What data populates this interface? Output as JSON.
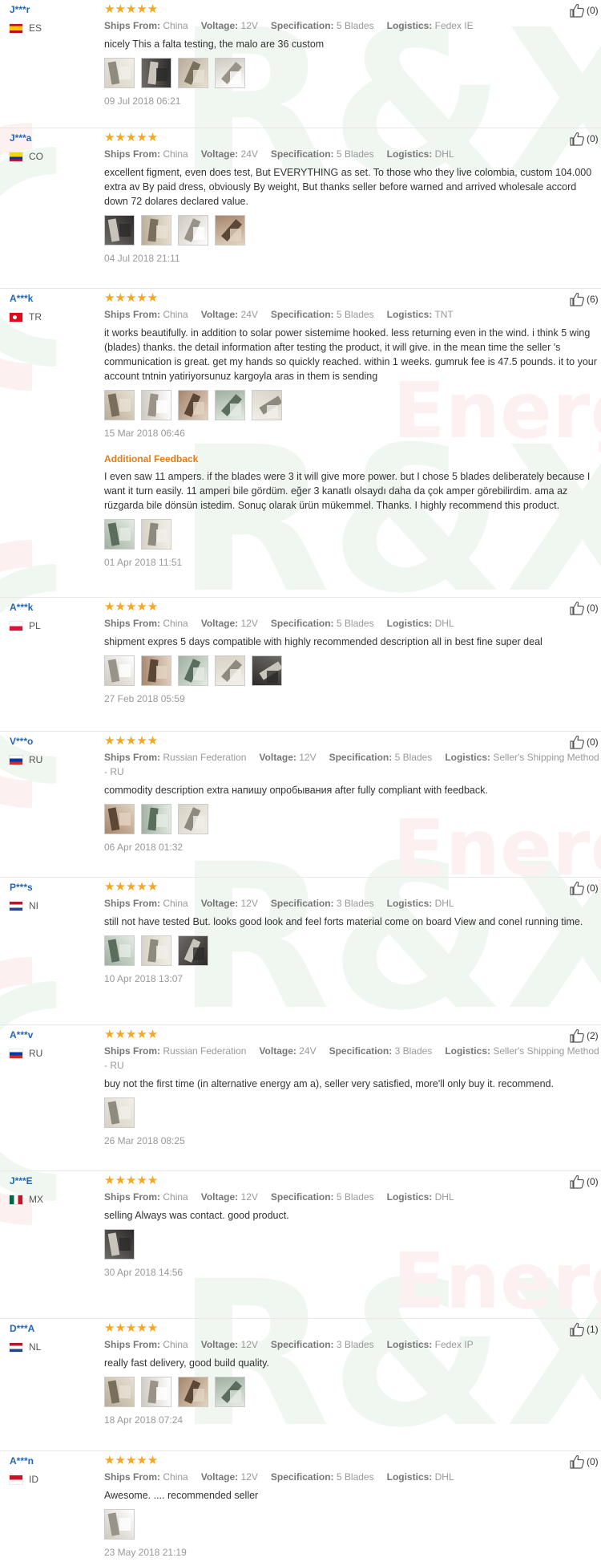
{
  "watermark": {
    "brand": "R&X",
    "word": "Energy"
  },
  "labels": {
    "ships_from": "Ships From:",
    "voltage": "Voltage:",
    "specification": "Specification:",
    "logistics": "Logistics:",
    "additional_feedback": "Additional Feedback"
  },
  "colors": {
    "star": "#f5a623",
    "user_name": "#2366b8",
    "feedback_title": "#e07d19"
  },
  "reviews": [
    {
      "user": "J***r",
      "country": "ES",
      "flag": "flag-es",
      "stars": "★★★★★",
      "ships_from": "China",
      "voltage": "12V",
      "specification": "5 Blades",
      "logistics": "Fedex IE",
      "text": "nicely This a falta testing, the malo are 36 custom",
      "photos": 4,
      "date": "09 Jul 2018 06:21",
      "helpful": "(0)"
    },
    {
      "user": "J***a",
      "country": "CO",
      "flag": "flag-co",
      "stars": "★★★★★",
      "ships_from": "China",
      "voltage": "24V",
      "specification": "5 Blades",
      "logistics": "DHL",
      "text": "excellent figment, even does test, But EVERYTHING as set. To those who they live colombia, custom 104.000 extra av By paid dress, obviously By weight, But thanks seller before warned and arrived wholesale accord down 72 dolares declared value.",
      "photos": 4,
      "date": "04 Jul 2018 21:11",
      "helpful": "(0)"
    },
    {
      "user": "A***k",
      "country": "TR",
      "flag": "flag-tr",
      "stars": "★★★★★",
      "ships_from": "China",
      "voltage": "24V",
      "specification": "5 Blades",
      "logistics": "TNT",
      "text": "it works beautifully. in addition to solar power sistemime hooked. less returning even in the wind. i think 5 wing (blades) thanks. the detail information after testing the product, it will give. in the mean time the seller 's communication is great. get my hands so quickly reached. within 1 weeks. gumruk fee is 47.5 pounds. it to your account tntnin yatiriyorsunuz kargoyla aras in them is sending",
      "photos": 5,
      "date": "15 Mar 2018 06:46",
      "helpful": "(6)",
      "additional": {
        "text": "I even saw 11 ampers. if the blades were 3 it will give more power. but I chose 5 blades deliberately because I want it turn easily. 11 amperi bile gördüm. eğer 3 kanatlı olsaydı daha da çok amper görebilirdim. ama az rüzgarda bile dönsün istedim. Sonuç olarak ürün mükemmel. Thanks. I highly recommend this product.",
        "photos": 2,
        "date": "01 Apr 2018 11:51"
      }
    },
    {
      "user": "A***k",
      "country": "PL",
      "flag": "flag-pl",
      "stars": "★★★★★",
      "ships_from": "China",
      "voltage": "12V",
      "specification": "5 Blades",
      "logistics": "DHL",
      "text": "shipment expres 5 days compatible with highly recommended description all in best fine super deal",
      "photos": 5,
      "date": "27 Feb 2018 05:59",
      "helpful": "(0)"
    },
    {
      "user": "V***o",
      "country": "RU",
      "flag": "flag-ru",
      "stars": "★★★★★",
      "ships_from": "Russian Federation",
      "voltage": "12V",
      "specification": "5 Blades",
      "logistics": "Seller's Shipping Method - RU",
      "text": "commodity description extra напишу опробывания after fully compliant with feedback.",
      "photos": 3,
      "date": "06 Apr 2018 01:32",
      "helpful": "(0)"
    },
    {
      "user": "P***s",
      "country": "NI",
      "flag": "flag-nl",
      "stars": "★★★★★",
      "ships_from": "China",
      "voltage": "12V",
      "specification": "3 Blades",
      "logistics": "DHL",
      "text": "still not have tested But. looks good look and feel forts material come on board View and conel running time.",
      "photos": 3,
      "date": "10 Apr 2018 13:07",
      "helpful": "(0)"
    },
    {
      "user": "A***v",
      "country": "RU",
      "flag": "flag-ru",
      "stars": "★★★★★",
      "ships_from": "Russian Federation",
      "voltage": "24V",
      "specification": "3 Blades",
      "logistics": "Seller's Shipping Method - RU",
      "text": "buy not the first time (in alternative energy am a), seller very satisfied, more'll only buy it. recommend.",
      "photos": 1,
      "date": "26 Mar 2018 08:25",
      "helpful": "(2)"
    },
    {
      "user": "J***E",
      "country": "MX",
      "flag": "flag-mx",
      "stars": "★★★★★",
      "ships_from": "China",
      "voltage": "12V",
      "specification": "5 Blades",
      "logistics": "DHL",
      "text": "selling Always was contact. good product.",
      "photos": 1,
      "date": "30 Apr 2018 14:56",
      "helpful": "(0)"
    },
    {
      "user": "D***A",
      "country": "NL",
      "flag": "flag-nl",
      "stars": "★★★★★",
      "ships_from": "China",
      "voltage": "12V",
      "specification": "3 Blades",
      "logistics": "Fedex IP",
      "text": "really fast delivery, good build quality.",
      "photos": 4,
      "date": "18 Apr 2018 07:24",
      "helpful": "(1)"
    },
    {
      "user": "A***n",
      "country": "ID",
      "flag": "flag-id",
      "stars": "★★★★★",
      "ships_from": "China",
      "voltage": "12V",
      "specification": "5 Blades",
      "logistics": "DHL",
      "text": "Awesome. .... recommended seller",
      "photos": 1,
      "date": "23 May 2018 21:19",
      "helpful": "(0)"
    }
  ]
}
